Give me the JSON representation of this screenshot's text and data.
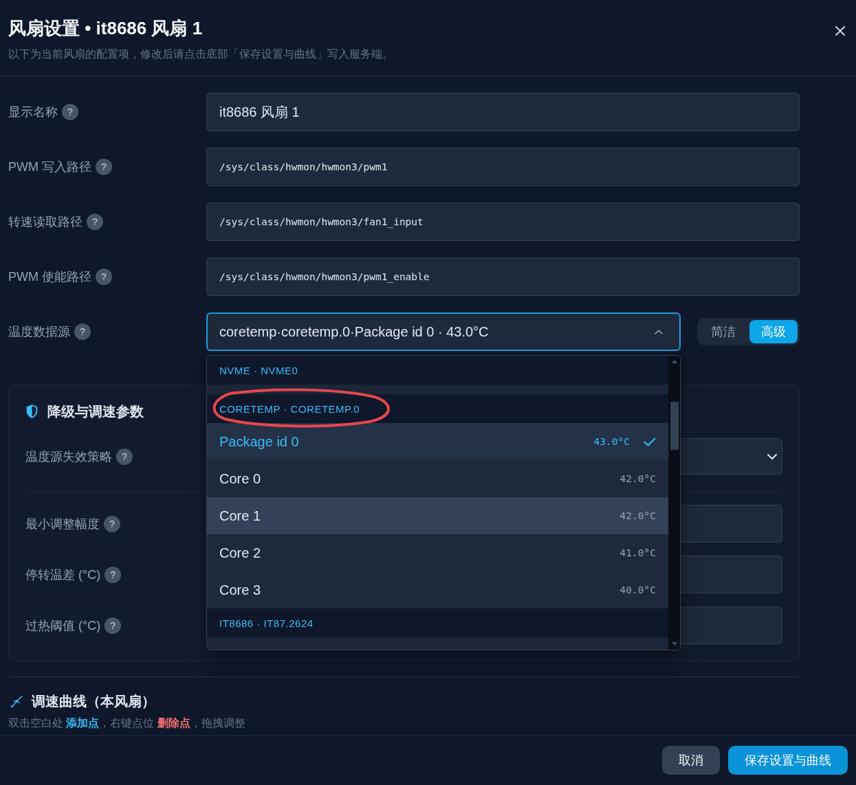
{
  "dialog": {
    "title": "风扇设置 • it8686 风扇 1",
    "subtitle": "以下为当前风扇的配置项，修改后请点击底部「保存设置与曲线」写入服务端。"
  },
  "form": {
    "fields": [
      {
        "label": "显示名称",
        "help": "?",
        "kind": "text",
        "value": "it8686 风扇 1"
      },
      {
        "label": "PWM 写入路径",
        "help": "?",
        "kind": "path",
        "value": "/sys/class/hwmon/hwmon3/pwm1"
      },
      {
        "label": "转速读取路径",
        "help": "?",
        "kind": "path",
        "value": "/sys/class/hwmon/hwmon3/fan1_input"
      },
      {
        "label": "PWM 使能路径",
        "help": "?",
        "kind": "path",
        "value": "/sys/class/hwmon/hwmon3/pwm1_enable"
      }
    ]
  },
  "source": {
    "label": "温度数据源",
    "help": "?",
    "value": "coretemp·coretemp.0·Package id 0 · 43.0°C",
    "expanded": true,
    "mode_toggle": [
      {
        "label": "简洁",
        "selected": false
      },
      {
        "label": "高级",
        "selected": true
      }
    ],
    "dropdown": {
      "groups": [
        {
          "label": "NVME · NVME0",
          "circled": false
        },
        {
          "label": "CORETEMP · CORETEMP.0",
          "circled": true,
          "options": [
            {
              "label": "Package id 0",
              "reading": "43.0°C",
              "selected": true,
              "highlighted": false
            },
            {
              "label": "Core 0",
              "reading": "42.0°C",
              "selected": false,
              "highlighted": false
            },
            {
              "label": "Core 1",
              "reading": "42.0°C",
              "selected": false,
              "highlighted": true
            },
            {
              "label": "Core 2",
              "reading": "41.0°C",
              "selected": false,
              "highlighted": false
            },
            {
              "label": "Core 3",
              "reading": "40.0°C",
              "selected": false,
              "highlighted": false
            }
          ]
        },
        {
          "label": "IT8686 · IT87.2624",
          "circled": false
        }
      ]
    }
  },
  "settings_card": {
    "title": "降级与调速参数",
    "fields": [
      {
        "label": "温度源失效策略",
        "help": "?",
        "kind": "select"
      },
      {
        "label": "最小调整幅度",
        "help": "?",
        "kind": "input"
      },
      {
        "label": "停转温差 (°C)",
        "help": "?",
        "kind": "input"
      },
      {
        "label": "过热阈值 (°C)",
        "help": "?",
        "kind": "input"
      }
    ]
  },
  "curve_section": {
    "title": "调速曲线（本风扇）",
    "hint": [
      {
        "text": "双击空白处 ",
        "kind": "plain"
      },
      {
        "text": "添加点",
        "kind": "add"
      },
      {
        "text": "，右键点位 ",
        "kind": "plain"
      },
      {
        "text": "删除点",
        "kind": "remove"
      },
      {
        "text": "，拖拽调整",
        "kind": "plain"
      }
    ]
  },
  "footer": {
    "buttons": [
      {
        "label": "取消",
        "kind": "secondary"
      },
      {
        "label": "保存设置与曲线",
        "kind": "primary"
      }
    ]
  }
}
